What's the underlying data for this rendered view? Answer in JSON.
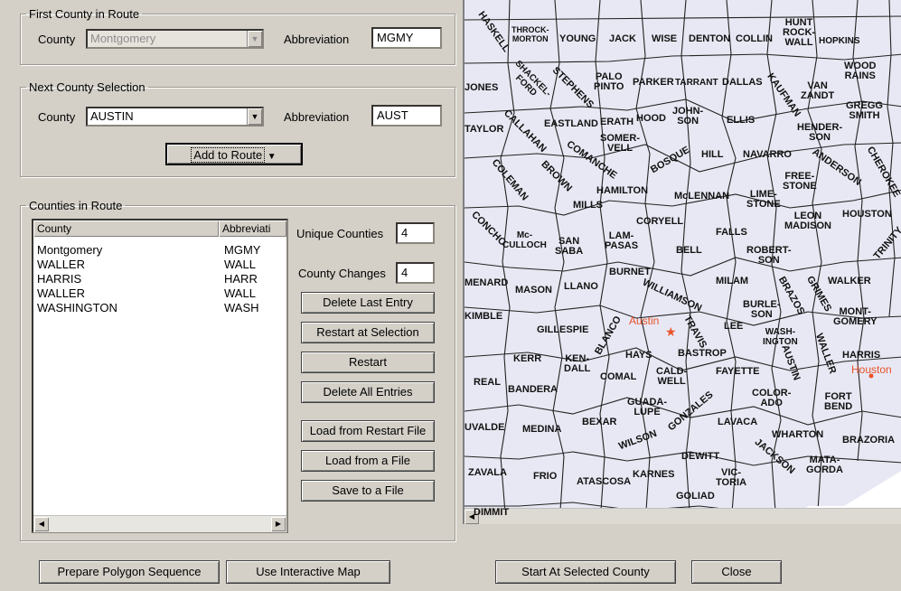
{
  "first_county": {
    "legend": "First County in Route",
    "county_label": "County",
    "county_value": "Montgomery",
    "abbrev_label": "Abbreviation",
    "abbrev_value": "MGMY"
  },
  "next_county": {
    "legend": "Next County Selection",
    "county_label": "County",
    "county_value": "AUSTIN",
    "abbrev_label": "Abbreviation",
    "abbrev_value": "AUST",
    "add_button": "Add to Route"
  },
  "route": {
    "legend": "Counties in Route",
    "columns": [
      "County",
      "Abbreviati"
    ],
    "rows": [
      {
        "county": "Montgomery",
        "abbrev": "MGMY"
      },
      {
        "county": "WALLER",
        "abbrev": "WALL"
      },
      {
        "county": "HARRIS",
        "abbrev": "HARR"
      },
      {
        "county": "WALLER",
        "abbrev": "WALL"
      },
      {
        "county": "WASHINGTON",
        "abbrev": "WASH"
      }
    ],
    "unique_label": "Unique Counties",
    "unique_value": "4",
    "changes_label": "County Changes",
    "changes_value": "4",
    "buttons": {
      "delete_last": "Delete Last Entry",
      "restart_sel": "Restart at Selection",
      "restart": "Restart",
      "delete_all": "Delete All Entries",
      "load_restart": "Load from Restart File",
      "load_file": "Load from a File",
      "save_file": "Save to a File"
    }
  },
  "bottom": {
    "prepare": "Prepare Polygon Sequence",
    "interactive": "Use Interactive Map",
    "start": "Start At Selected County",
    "close": "Close"
  },
  "map": {
    "counties": [
      {
        "id": "haskell",
        "text": "HASKELL"
      },
      {
        "id": "throckmorton",
        "text": "THROCK-\nMORTON"
      },
      {
        "id": "young",
        "text": "YOUNG"
      },
      {
        "id": "jack",
        "text": "JACK"
      },
      {
        "id": "wise",
        "text": "WISE"
      },
      {
        "id": "denton",
        "text": "DENTON"
      },
      {
        "id": "collin",
        "text": "COLLIN"
      },
      {
        "id": "hunt",
        "text": "HUNT\nROCK-\nWALL"
      },
      {
        "id": "hopkins",
        "text": "HOPKINS"
      },
      {
        "id": "jones",
        "text": "JONES"
      },
      {
        "id": "shackelford",
        "text": "SHACKEL-\nFORD"
      },
      {
        "id": "stephens",
        "text": "STEPHENS"
      },
      {
        "id": "palopinto",
        "text": "PALO\nPINTO"
      },
      {
        "id": "parker",
        "text": "PARKER"
      },
      {
        "id": "tarrant",
        "text": "TARRANT"
      },
      {
        "id": "dallas",
        "text": "DALLAS"
      },
      {
        "id": "kaufman",
        "text": "KAUFMAN"
      },
      {
        "id": "vanzandt",
        "text": "VAN\nZANDT"
      },
      {
        "id": "wood",
        "text": "WOOD\nRAINS"
      },
      {
        "id": "gregg",
        "text": "GREGG\nSMITH"
      },
      {
        "id": "taylor",
        "text": "TAYLOR"
      },
      {
        "id": "callahan",
        "text": "CALLAHAN"
      },
      {
        "id": "eastland",
        "text": "EASTLAND"
      },
      {
        "id": "erath",
        "text": "ERATH"
      },
      {
        "id": "hood",
        "text": "HOOD"
      },
      {
        "id": "johnson",
        "text": "JOHN-\nSON"
      },
      {
        "id": "ellis",
        "text": "ELLIS"
      },
      {
        "id": "henderson",
        "text": "HENDER-\nSON"
      },
      {
        "id": "somervell",
        "text": "SOMER-\nVELL"
      },
      {
        "id": "comanche",
        "text": "COMANCHE"
      },
      {
        "id": "bosque",
        "text": "BOSQUE"
      },
      {
        "id": "hill",
        "text": "HILL"
      },
      {
        "id": "navarro",
        "text": "NAVARRO"
      },
      {
        "id": "anderson",
        "text": "ANDERSON"
      },
      {
        "id": "cherokee",
        "text": "CHEROKEE"
      },
      {
        "id": "coleman",
        "text": "COLEMAN"
      },
      {
        "id": "brown",
        "text": "BROWN"
      },
      {
        "id": "hamilton",
        "text": "HAMILTON"
      },
      {
        "id": "freestone",
        "text": "FREE-\nSTONE"
      },
      {
        "id": "mills",
        "text": "MILLS"
      },
      {
        "id": "mclennan",
        "text": "McLENNAN"
      },
      {
        "id": "limestone",
        "text": "LIME-\nSTONE"
      },
      {
        "id": "coryell",
        "text": "CORYELL"
      },
      {
        "id": "leon",
        "text": "LEON\nMADISON"
      },
      {
        "id": "houston",
        "text": "HOUSTON"
      },
      {
        "id": "concho",
        "text": "CONCHO"
      },
      {
        "id": "mcculloch",
        "text": "Mc-\nCULLOCH"
      },
      {
        "id": "sansaba",
        "text": "SAN\nSABA"
      },
      {
        "id": "lampasas",
        "text": "LAM-\nPASAS"
      },
      {
        "id": "bell",
        "text": "BELL"
      },
      {
        "id": "falls",
        "text": "FALLS"
      },
      {
        "id": "robertson",
        "text": "ROBERT-\nSON"
      },
      {
        "id": "trinity",
        "text": "TRINITY"
      },
      {
        "id": "menard",
        "text": "MENARD"
      },
      {
        "id": "mason",
        "text": "MASON"
      },
      {
        "id": "llano",
        "text": "LLANO"
      },
      {
        "id": "burnet",
        "text": "BURNET"
      },
      {
        "id": "williamson",
        "text": "WILLIAMSON"
      },
      {
        "id": "milam",
        "text": "MILAM"
      },
      {
        "id": "walker",
        "text": "WALKER"
      },
      {
        "id": "grimes",
        "text": "GRIMES"
      },
      {
        "id": "kimble",
        "text": "KIMBLE"
      },
      {
        "id": "burleson",
        "text": "BURLE-\nSON"
      },
      {
        "id": "brazos",
        "text": "BRAZOS"
      },
      {
        "id": "montgomery",
        "text": "MONT-\nGOMERY"
      },
      {
        "id": "gillespie",
        "text": "GILLESPIE"
      },
      {
        "id": "blanco",
        "text": "BLANCO"
      },
      {
        "id": "travis",
        "text": "TRAVIS"
      },
      {
        "id": "lee",
        "text": "LEE"
      },
      {
        "id": "washington",
        "text": "WASH-\nINGTON"
      },
      {
        "id": "kerr",
        "text": "KERR"
      },
      {
        "id": "kendall",
        "text": "KEN-\nDALL"
      },
      {
        "id": "hays",
        "text": "HAYS"
      },
      {
        "id": "bastrop",
        "text": "BASTROP"
      },
      {
        "id": "waller",
        "text": "WALLER"
      },
      {
        "id": "harris",
        "text": "HARRIS"
      },
      {
        "id": "real",
        "text": "REAL"
      },
      {
        "id": "bandera",
        "text": "BANDERA"
      },
      {
        "id": "comal",
        "text": "COMAL"
      },
      {
        "id": "caldwell",
        "text": "CALD-\nWELL"
      },
      {
        "id": "fayette",
        "text": "FAYETTE"
      },
      {
        "id": "austin",
        "text": "AUSTIN"
      },
      {
        "id": "colorado",
        "text": "COLOR-\nADO"
      },
      {
        "id": "fortbend",
        "text": "FORT\nBEND"
      },
      {
        "id": "guadalupe",
        "text": "GUADA-\nLUPE"
      },
      {
        "id": "bexar",
        "text": "BEXAR"
      },
      {
        "id": "gonzales",
        "text": "GONZALES"
      },
      {
        "id": "uvalde",
        "text": "UVALDE"
      },
      {
        "id": "medina",
        "text": "MEDINA"
      },
      {
        "id": "wilson",
        "text": "WILSON"
      },
      {
        "id": "lavaca",
        "text": "LAVACA"
      },
      {
        "id": "wharton",
        "text": "WHARTON"
      },
      {
        "id": "brazoria",
        "text": "BRAZORIA"
      },
      {
        "id": "dewitt",
        "text": "DEWITT"
      },
      {
        "id": "jackson",
        "text": "JACKSON"
      },
      {
        "id": "matagorda",
        "text": "MATA-\nGORDA"
      },
      {
        "id": "zavala",
        "text": "ZAVALA"
      },
      {
        "id": "frio",
        "text": "FRIO"
      },
      {
        "id": "atascosa",
        "text": "ATASCOSA"
      },
      {
        "id": "karnes",
        "text": "KARNES"
      },
      {
        "id": "victoria",
        "text": "VIC-\nTORIA"
      },
      {
        "id": "goliad",
        "text": "GOLIAD"
      },
      {
        "id": "dimmit",
        "text": "DIMMIT"
      }
    ],
    "cities": [
      {
        "id": "austin-city",
        "text": "Austin"
      },
      {
        "id": "houston-city",
        "text": "Houston"
      }
    ]
  }
}
